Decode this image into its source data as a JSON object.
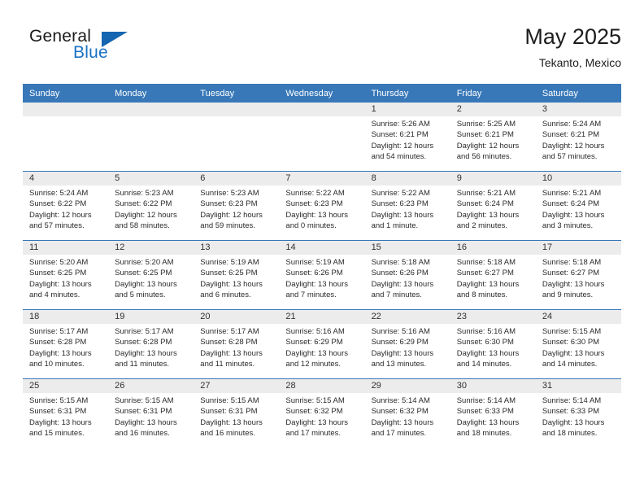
{
  "brand": {
    "name_part1": "General",
    "name_part2": "Blue",
    "triangle_color": "#1565b0",
    "blue_text_color": "#1a72c4"
  },
  "header": {
    "title": "May 2025",
    "location": "Tekanto, Mexico",
    "accent_color": "#3878b8",
    "daynum_strip_color": "#ececec"
  },
  "weekdays": [
    "Sunday",
    "Monday",
    "Tuesday",
    "Wednesday",
    "Thursday",
    "Friday",
    "Saturday"
  ],
  "labels": {
    "sunrise_prefix": "Sunrise:",
    "sunset_prefix": "Sunset:",
    "daylight_prefix": "Daylight:"
  },
  "weeks": [
    [
      {
        "day": "",
        "empty": true
      },
      {
        "day": "",
        "empty": true
      },
      {
        "day": "",
        "empty": true
      },
      {
        "day": "",
        "empty": true
      },
      {
        "day": "1",
        "sunrise": "Sunrise: 5:26 AM",
        "sunset": "Sunset: 6:21 PM",
        "daylight_line1": "Daylight: 12 hours",
        "daylight_line2": "and 54 minutes."
      },
      {
        "day": "2",
        "sunrise": "Sunrise: 5:25 AM",
        "sunset": "Sunset: 6:21 PM",
        "daylight_line1": "Daylight: 12 hours",
        "daylight_line2": "and 56 minutes."
      },
      {
        "day": "3",
        "sunrise": "Sunrise: 5:24 AM",
        "sunset": "Sunset: 6:21 PM",
        "daylight_line1": "Daylight: 12 hours",
        "daylight_line2": "and 57 minutes."
      }
    ],
    [
      {
        "day": "4",
        "sunrise": "Sunrise: 5:24 AM",
        "sunset": "Sunset: 6:22 PM",
        "daylight_line1": "Daylight: 12 hours",
        "daylight_line2": "and 57 minutes."
      },
      {
        "day": "5",
        "sunrise": "Sunrise: 5:23 AM",
        "sunset": "Sunset: 6:22 PM",
        "daylight_line1": "Daylight: 12 hours",
        "daylight_line2": "and 58 minutes."
      },
      {
        "day": "6",
        "sunrise": "Sunrise: 5:23 AM",
        "sunset": "Sunset: 6:23 PM",
        "daylight_line1": "Daylight: 12 hours",
        "daylight_line2": "and 59 minutes."
      },
      {
        "day": "7",
        "sunrise": "Sunrise: 5:22 AM",
        "sunset": "Sunset: 6:23 PM",
        "daylight_line1": "Daylight: 13 hours",
        "daylight_line2": "and 0 minutes."
      },
      {
        "day": "8",
        "sunrise": "Sunrise: 5:22 AM",
        "sunset": "Sunset: 6:23 PM",
        "daylight_line1": "Daylight: 13 hours",
        "daylight_line2": "and 1 minute."
      },
      {
        "day": "9",
        "sunrise": "Sunrise: 5:21 AM",
        "sunset": "Sunset: 6:24 PM",
        "daylight_line1": "Daylight: 13 hours",
        "daylight_line2": "and 2 minutes."
      },
      {
        "day": "10",
        "sunrise": "Sunrise: 5:21 AM",
        "sunset": "Sunset: 6:24 PM",
        "daylight_line1": "Daylight: 13 hours",
        "daylight_line2": "and 3 minutes."
      }
    ],
    [
      {
        "day": "11",
        "sunrise": "Sunrise: 5:20 AM",
        "sunset": "Sunset: 6:25 PM",
        "daylight_line1": "Daylight: 13 hours",
        "daylight_line2": "and 4 minutes."
      },
      {
        "day": "12",
        "sunrise": "Sunrise: 5:20 AM",
        "sunset": "Sunset: 6:25 PM",
        "daylight_line1": "Daylight: 13 hours",
        "daylight_line2": "and 5 minutes."
      },
      {
        "day": "13",
        "sunrise": "Sunrise: 5:19 AM",
        "sunset": "Sunset: 6:25 PM",
        "daylight_line1": "Daylight: 13 hours",
        "daylight_line2": "and 6 minutes."
      },
      {
        "day": "14",
        "sunrise": "Sunrise: 5:19 AM",
        "sunset": "Sunset: 6:26 PM",
        "daylight_line1": "Daylight: 13 hours",
        "daylight_line2": "and 7 minutes."
      },
      {
        "day": "15",
        "sunrise": "Sunrise: 5:18 AM",
        "sunset": "Sunset: 6:26 PM",
        "daylight_line1": "Daylight: 13 hours",
        "daylight_line2": "and 7 minutes."
      },
      {
        "day": "16",
        "sunrise": "Sunrise: 5:18 AM",
        "sunset": "Sunset: 6:27 PM",
        "daylight_line1": "Daylight: 13 hours",
        "daylight_line2": "and 8 minutes."
      },
      {
        "day": "17",
        "sunrise": "Sunrise: 5:18 AM",
        "sunset": "Sunset: 6:27 PM",
        "daylight_line1": "Daylight: 13 hours",
        "daylight_line2": "and 9 minutes."
      }
    ],
    [
      {
        "day": "18",
        "sunrise": "Sunrise: 5:17 AM",
        "sunset": "Sunset: 6:28 PM",
        "daylight_line1": "Daylight: 13 hours",
        "daylight_line2": "and 10 minutes."
      },
      {
        "day": "19",
        "sunrise": "Sunrise: 5:17 AM",
        "sunset": "Sunset: 6:28 PM",
        "daylight_line1": "Daylight: 13 hours",
        "daylight_line2": "and 11 minutes."
      },
      {
        "day": "20",
        "sunrise": "Sunrise: 5:17 AM",
        "sunset": "Sunset: 6:28 PM",
        "daylight_line1": "Daylight: 13 hours",
        "daylight_line2": "and 11 minutes."
      },
      {
        "day": "21",
        "sunrise": "Sunrise: 5:16 AM",
        "sunset": "Sunset: 6:29 PM",
        "daylight_line1": "Daylight: 13 hours",
        "daylight_line2": "and 12 minutes."
      },
      {
        "day": "22",
        "sunrise": "Sunrise: 5:16 AM",
        "sunset": "Sunset: 6:29 PM",
        "daylight_line1": "Daylight: 13 hours",
        "daylight_line2": "and 13 minutes."
      },
      {
        "day": "23",
        "sunrise": "Sunrise: 5:16 AM",
        "sunset": "Sunset: 6:30 PM",
        "daylight_line1": "Daylight: 13 hours",
        "daylight_line2": "and 14 minutes."
      },
      {
        "day": "24",
        "sunrise": "Sunrise: 5:15 AM",
        "sunset": "Sunset: 6:30 PM",
        "daylight_line1": "Daylight: 13 hours",
        "daylight_line2": "and 14 minutes."
      }
    ],
    [
      {
        "day": "25",
        "sunrise": "Sunrise: 5:15 AM",
        "sunset": "Sunset: 6:31 PM",
        "daylight_line1": "Daylight: 13 hours",
        "daylight_line2": "and 15 minutes."
      },
      {
        "day": "26",
        "sunrise": "Sunrise: 5:15 AM",
        "sunset": "Sunset: 6:31 PM",
        "daylight_line1": "Daylight: 13 hours",
        "daylight_line2": "and 16 minutes."
      },
      {
        "day": "27",
        "sunrise": "Sunrise: 5:15 AM",
        "sunset": "Sunset: 6:31 PM",
        "daylight_line1": "Daylight: 13 hours",
        "daylight_line2": "and 16 minutes."
      },
      {
        "day": "28",
        "sunrise": "Sunrise: 5:15 AM",
        "sunset": "Sunset: 6:32 PM",
        "daylight_line1": "Daylight: 13 hours",
        "daylight_line2": "and 17 minutes."
      },
      {
        "day": "29",
        "sunrise": "Sunrise: 5:14 AM",
        "sunset": "Sunset: 6:32 PM",
        "daylight_line1": "Daylight: 13 hours",
        "daylight_line2": "and 17 minutes."
      },
      {
        "day": "30",
        "sunrise": "Sunrise: 5:14 AM",
        "sunset": "Sunset: 6:33 PM",
        "daylight_line1": "Daylight: 13 hours",
        "daylight_line2": "and 18 minutes."
      },
      {
        "day": "31",
        "sunrise": "Sunrise: 5:14 AM",
        "sunset": "Sunset: 6:33 PM",
        "daylight_line1": "Daylight: 13 hours",
        "daylight_line2": "and 18 minutes."
      }
    ]
  ]
}
